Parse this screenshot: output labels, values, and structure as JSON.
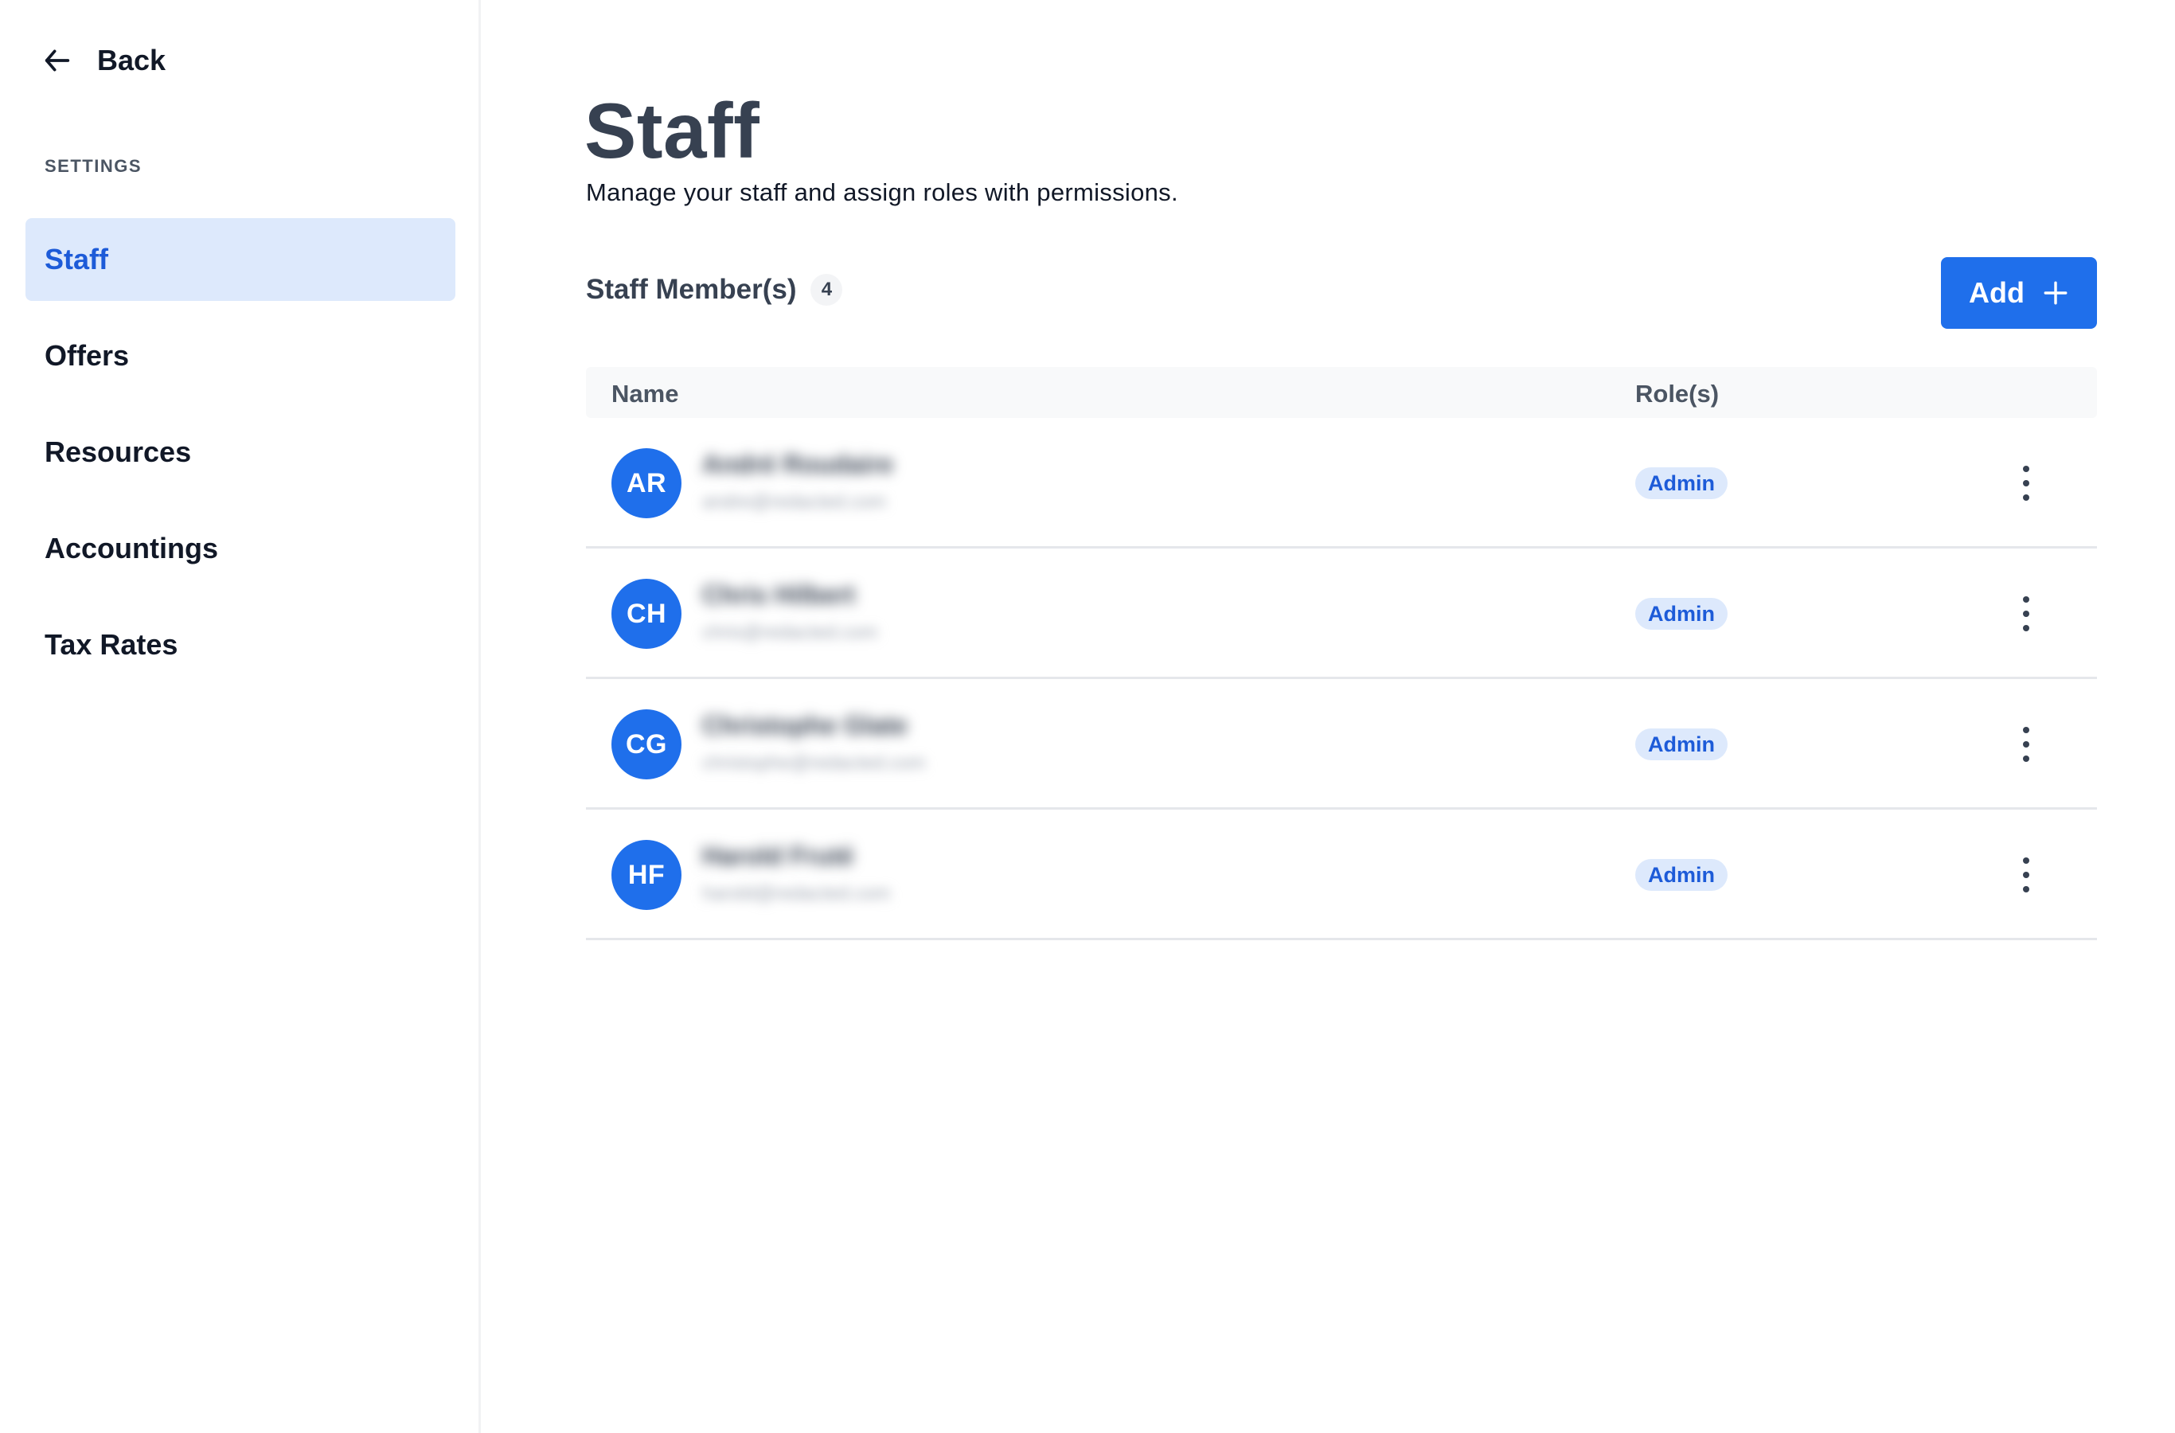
{
  "sidebar": {
    "back_label": "Back",
    "section_label": "SETTINGS",
    "items": [
      {
        "label": "Staff",
        "active": true
      },
      {
        "label": "Offers"
      },
      {
        "label": "Resources"
      },
      {
        "label": "Accountings"
      },
      {
        "label": "Tax Rates"
      }
    ]
  },
  "main": {
    "title": "Staff",
    "subtitle": "Manage your staff and assign roles with permissions.",
    "members_label": "Staff Member(s)",
    "members_count": "4",
    "add_label": "Add",
    "table": {
      "columns": {
        "name": "Name",
        "roles": "Role(s)"
      },
      "rows": [
        {
          "initials": "AR",
          "name": "André Roudaire",
          "email": "andre@redacted.com",
          "role": "Admin"
        },
        {
          "initials": "CH",
          "name": "Chris Hilbert",
          "email": "chris@redacted.com",
          "role": "Admin"
        },
        {
          "initials": "CG",
          "name": "Christophe Glate",
          "email": "christophe@redacted.com",
          "role": "Admin"
        },
        {
          "initials": "HF",
          "name": "Harold Fruté",
          "email": "harold@redacted.com",
          "role": "Admin"
        }
      ]
    }
  },
  "colors": {
    "accent": "#1f6feb",
    "active_bg": "#dde9fc",
    "active_text": "#1d5bd8"
  },
  "icons": {
    "back": "arrow-left-icon",
    "add": "plus-icon",
    "row_menu": "more-vertical-icon"
  }
}
